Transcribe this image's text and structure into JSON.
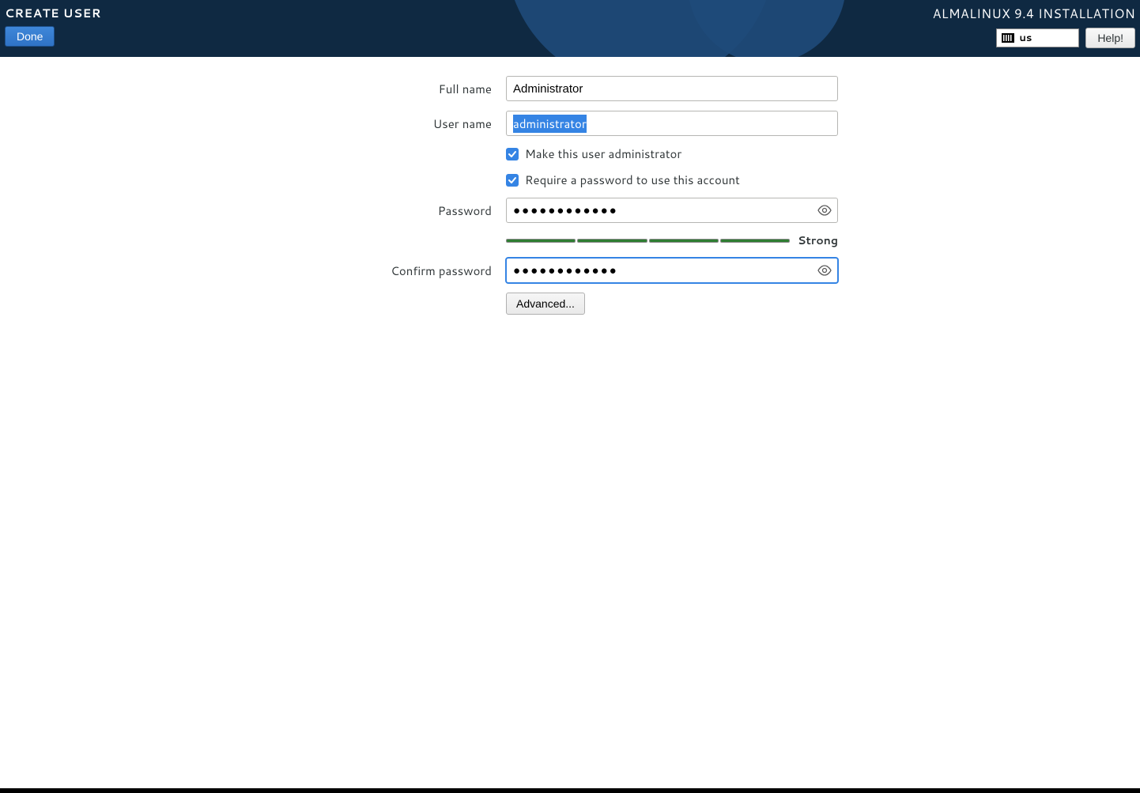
{
  "header": {
    "title": "CREATE USER",
    "install_label": "ALMALINUX 9.4 INSTALLATION",
    "done_label": "Done",
    "kbd_layout": "us",
    "help_label": "Help!"
  },
  "form": {
    "fullname_label": "Full name",
    "fullname_value": "Administrator",
    "username_label": "User name",
    "username_value": "administrator",
    "admin_checkbox_label": "Make this user administrator",
    "admin_checked": true,
    "require_pw_checkbox_label": "Require a password to use this account",
    "require_pw_checked": true,
    "password_label": "Password",
    "password_value": "●●●●●●●●●●●●",
    "strength_label": "Strong",
    "strength_segments": 4,
    "confirm_label": "Confirm password",
    "confirm_value": "●●●●●●●●●●●●",
    "advanced_label": "Advanced..."
  }
}
